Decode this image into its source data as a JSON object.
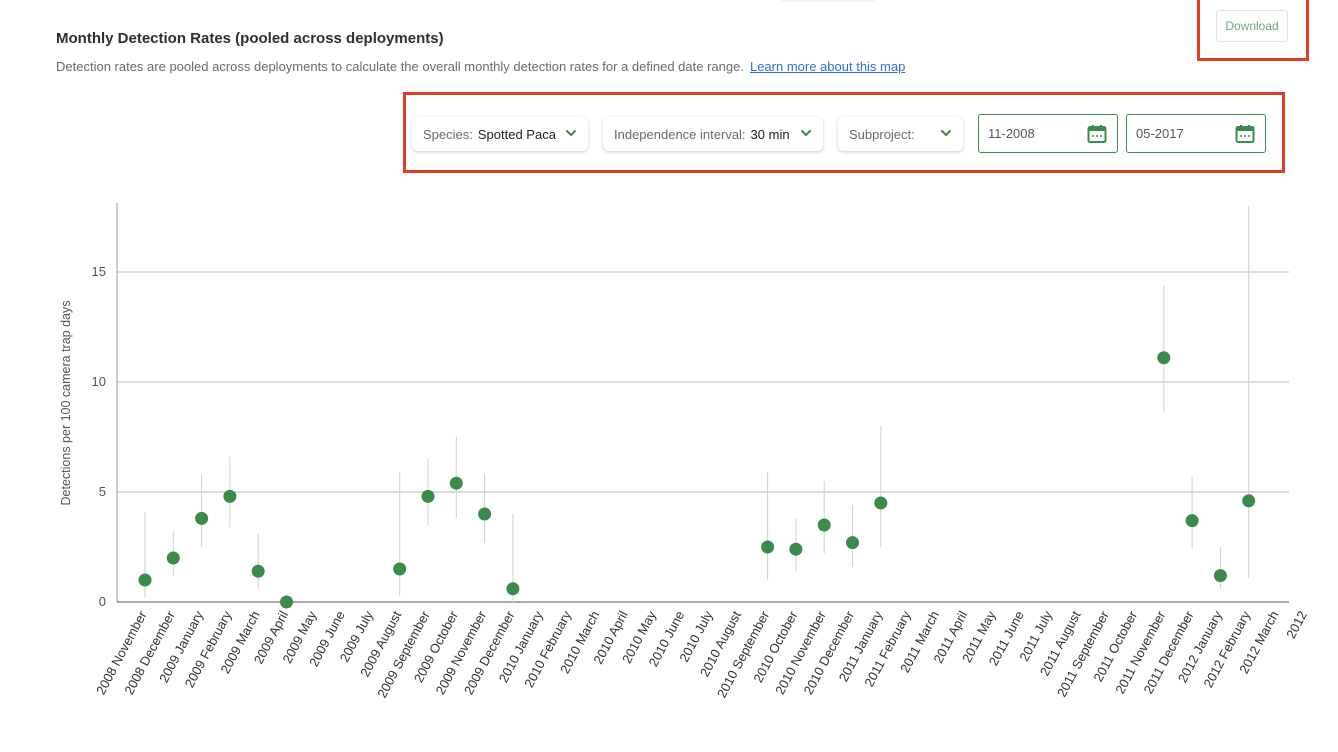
{
  "header": {
    "title": "Monthly Detection Rates (pooled across deployments)",
    "description": "Detection rates are pooled across deployments to calculate the overall monthly detection rates for a defined date range.",
    "learn_more": "Learn more about this map",
    "download_label": "Download"
  },
  "filters": {
    "species_label": "Species:",
    "species_value": "Spotted Paca",
    "interval_label": "Independence interval:",
    "interval_value": "30 min",
    "subproject_label": "Subproject:",
    "subproject_value": "",
    "start_date": "11-2008",
    "end_date": "05-2017"
  },
  "colors": {
    "accent": "#3d8b4c",
    "point": "#3b8a4b",
    "highlight": "#e03b24",
    "link": "#2f6fd3"
  },
  "icons": [
    "chevron-down-icon",
    "calendar-icon"
  ],
  "chart_data": {
    "type": "scatter",
    "ylabel": "Detections per 100 camera trap days",
    "yticks": [
      0,
      5,
      10,
      15
    ],
    "ylim": [
      0,
      18
    ],
    "error_bars": true,
    "categories": [
      "2008 November",
      "2008 December",
      "2009 January",
      "2009 February",
      "2009 March",
      "2009 April",
      "2009 May",
      "2009 June",
      "2009 July",
      "2009 August",
      "2009 September",
      "2009 October",
      "2009 November",
      "2009 December",
      "2010 January",
      "2010 February",
      "2010 March",
      "2010 April",
      "2010 May",
      "2010 June",
      "2010 July",
      "2010 August",
      "2010 September",
      "2010 October",
      "2010 November",
      "2010 December",
      "2011 January",
      "2011 February",
      "2011 March",
      "2011 April",
      "2011 May",
      "2011 June",
      "2011 July",
      "2011 August",
      "2011 September",
      "2011 October",
      "2011 November",
      "2011 December",
      "2012 January",
      "2012 February",
      "2012 March",
      "2012"
    ],
    "points": [
      {
        "x": "2008 November",
        "y": 1.0,
        "low": 0.2,
        "high": 4.1
      },
      {
        "x": "2008 December",
        "y": 2.0,
        "low": 1.2,
        "high": 3.2
      },
      {
        "x": "2009 January",
        "y": 3.8,
        "low": 2.5,
        "high": 5.8
      },
      {
        "x": "2009 February",
        "y": 4.8,
        "low": 3.4,
        "high": 6.6
      },
      {
        "x": "2009 March",
        "y": 1.4,
        "low": 0.6,
        "high": 3.1
      },
      {
        "x": "2009 April",
        "y": 0.0,
        "low": 0.0,
        "high": 0.4
      },
      {
        "x": "2009 August",
        "y": 1.5,
        "low": 0.3,
        "high": 5.9
      },
      {
        "x": "2009 September",
        "y": 4.8,
        "low": 3.5,
        "high": 6.5
      },
      {
        "x": "2009 October",
        "y": 5.4,
        "low": 3.8,
        "high": 7.5
      },
      {
        "x": "2009 November",
        "y": 4.0,
        "low": 2.7,
        "high": 5.8
      },
      {
        "x": "2009 December",
        "y": 0.6,
        "low": 0.0,
        "high": 4.0
      },
      {
        "x": "2010 September",
        "y": 2.5,
        "low": 1.0,
        "high": 5.9
      },
      {
        "x": "2010 October",
        "y": 2.4,
        "low": 1.4,
        "high": 3.8
      },
      {
        "x": "2010 November",
        "y": 3.5,
        "low": 2.2,
        "high": 5.5
      },
      {
        "x": "2010 December",
        "y": 2.7,
        "low": 1.6,
        "high": 4.4
      },
      {
        "x": "2011 January",
        "y": 4.5,
        "low": 2.5,
        "high": 8.0
      },
      {
        "x": "2011 November",
        "y": 11.1,
        "low": 8.6,
        "high": 14.4
      },
      {
        "x": "2011 December",
        "y": 3.7,
        "low": 2.4,
        "high": 5.7
      },
      {
        "x": "2012 January",
        "y": 1.2,
        "low": 0.6,
        "high": 2.5
      },
      {
        "x": "2012 February",
        "y": 4.6,
        "low": 1.1,
        "high": 18.0
      }
    ]
  }
}
